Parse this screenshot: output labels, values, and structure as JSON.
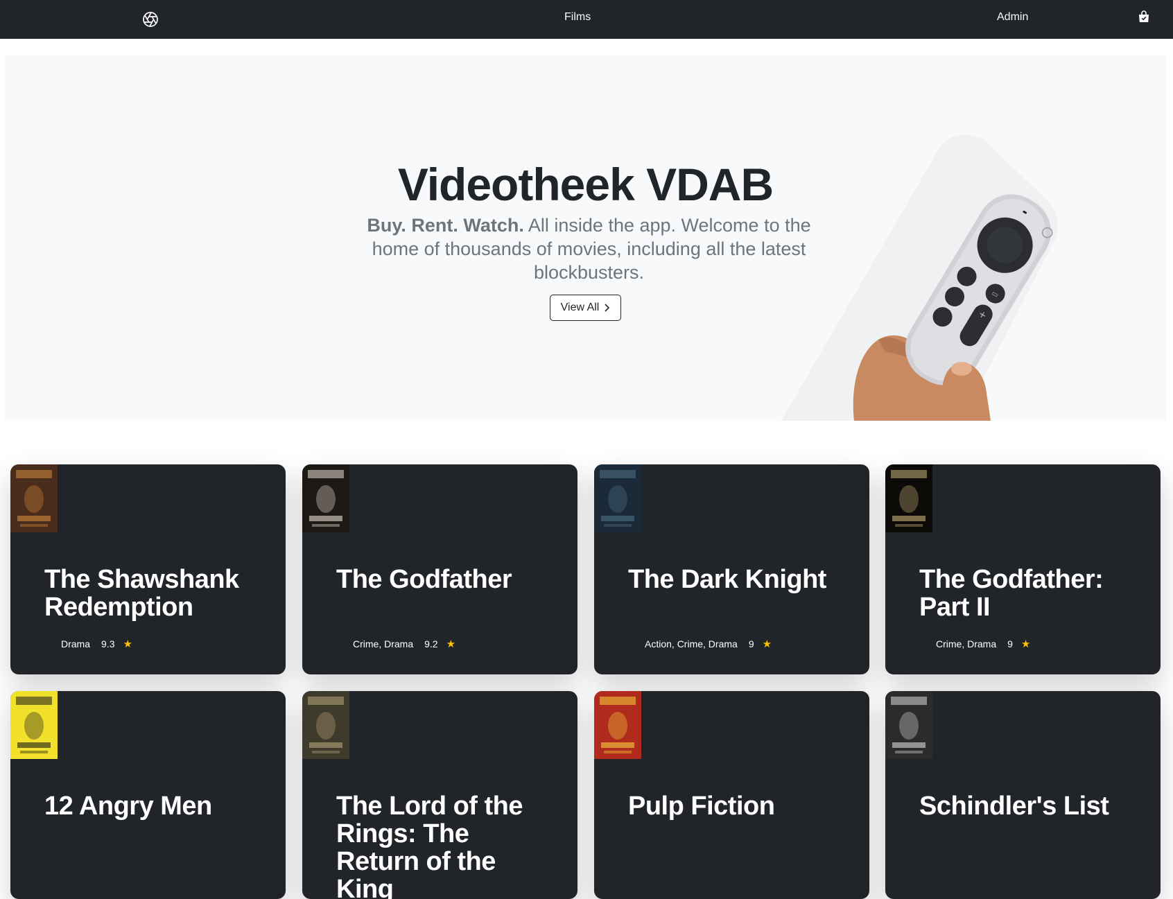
{
  "nav": {
    "logo_icon": "aperture-icon",
    "films_label": "Films",
    "admin_label": "Admin",
    "bag_icon": "shopping-bag-icon"
  },
  "hero": {
    "title": "Videotheek VDAB",
    "lead_bold": "Buy. Rent. Watch.",
    "lead_text": " All inside the app. Welcome to the home of thousands of movies, including all the latest blockbusters.",
    "button_label": "View All",
    "button_icon": "chevron-right-icon",
    "image": "hand-holding-remote-illustration"
  },
  "films": [
    {
      "title": "The Shawshank Redemption",
      "genres": "Drama",
      "rating": "9.3",
      "poster_bg": "#4a2c1c",
      "poster_accent": "#d08a3a"
    },
    {
      "title": "The Godfather",
      "genres": "Crime, Drama",
      "rating": "9.2",
      "poster_bg": "#1c1814",
      "poster_accent": "#e8e0d0"
    },
    {
      "title": "The Dark Knight",
      "genres": "Action, Crime, Drama",
      "rating": "9",
      "poster_bg": "#1b2a38",
      "poster_accent": "#4f6f86"
    },
    {
      "title": "The Godfather: Part II",
      "genres": "Crime, Drama",
      "rating": "9",
      "poster_bg": "#0d0b08",
      "poster_accent": "#c9b27a"
    },
    {
      "title": "12 Angry Men",
      "genres": "",
      "rating": "",
      "poster_bg": "#f2e12a",
      "poster_accent": "#1b1b1b"
    },
    {
      "title": "The Lord of the Rings: The Return of the King",
      "genres": "",
      "rating": "",
      "poster_bg": "#3e3a2c",
      "poster_accent": "#b9a57a"
    },
    {
      "title": "Pulp Fiction",
      "genres": "",
      "rating": "",
      "poster_bg": "#b02a1e",
      "poster_accent": "#f5d23a"
    },
    {
      "title": "Schindler's List",
      "genres": "",
      "rating": "",
      "poster_bg": "#2b2b2b",
      "poster_accent": "#d8d8d8"
    }
  ],
  "rating_icon": "star-icon",
  "colors": {
    "nav_bg": "#212529",
    "card_bg": "#212529",
    "hero_bg": "#f8f9fa",
    "star": "#ffc107"
  }
}
